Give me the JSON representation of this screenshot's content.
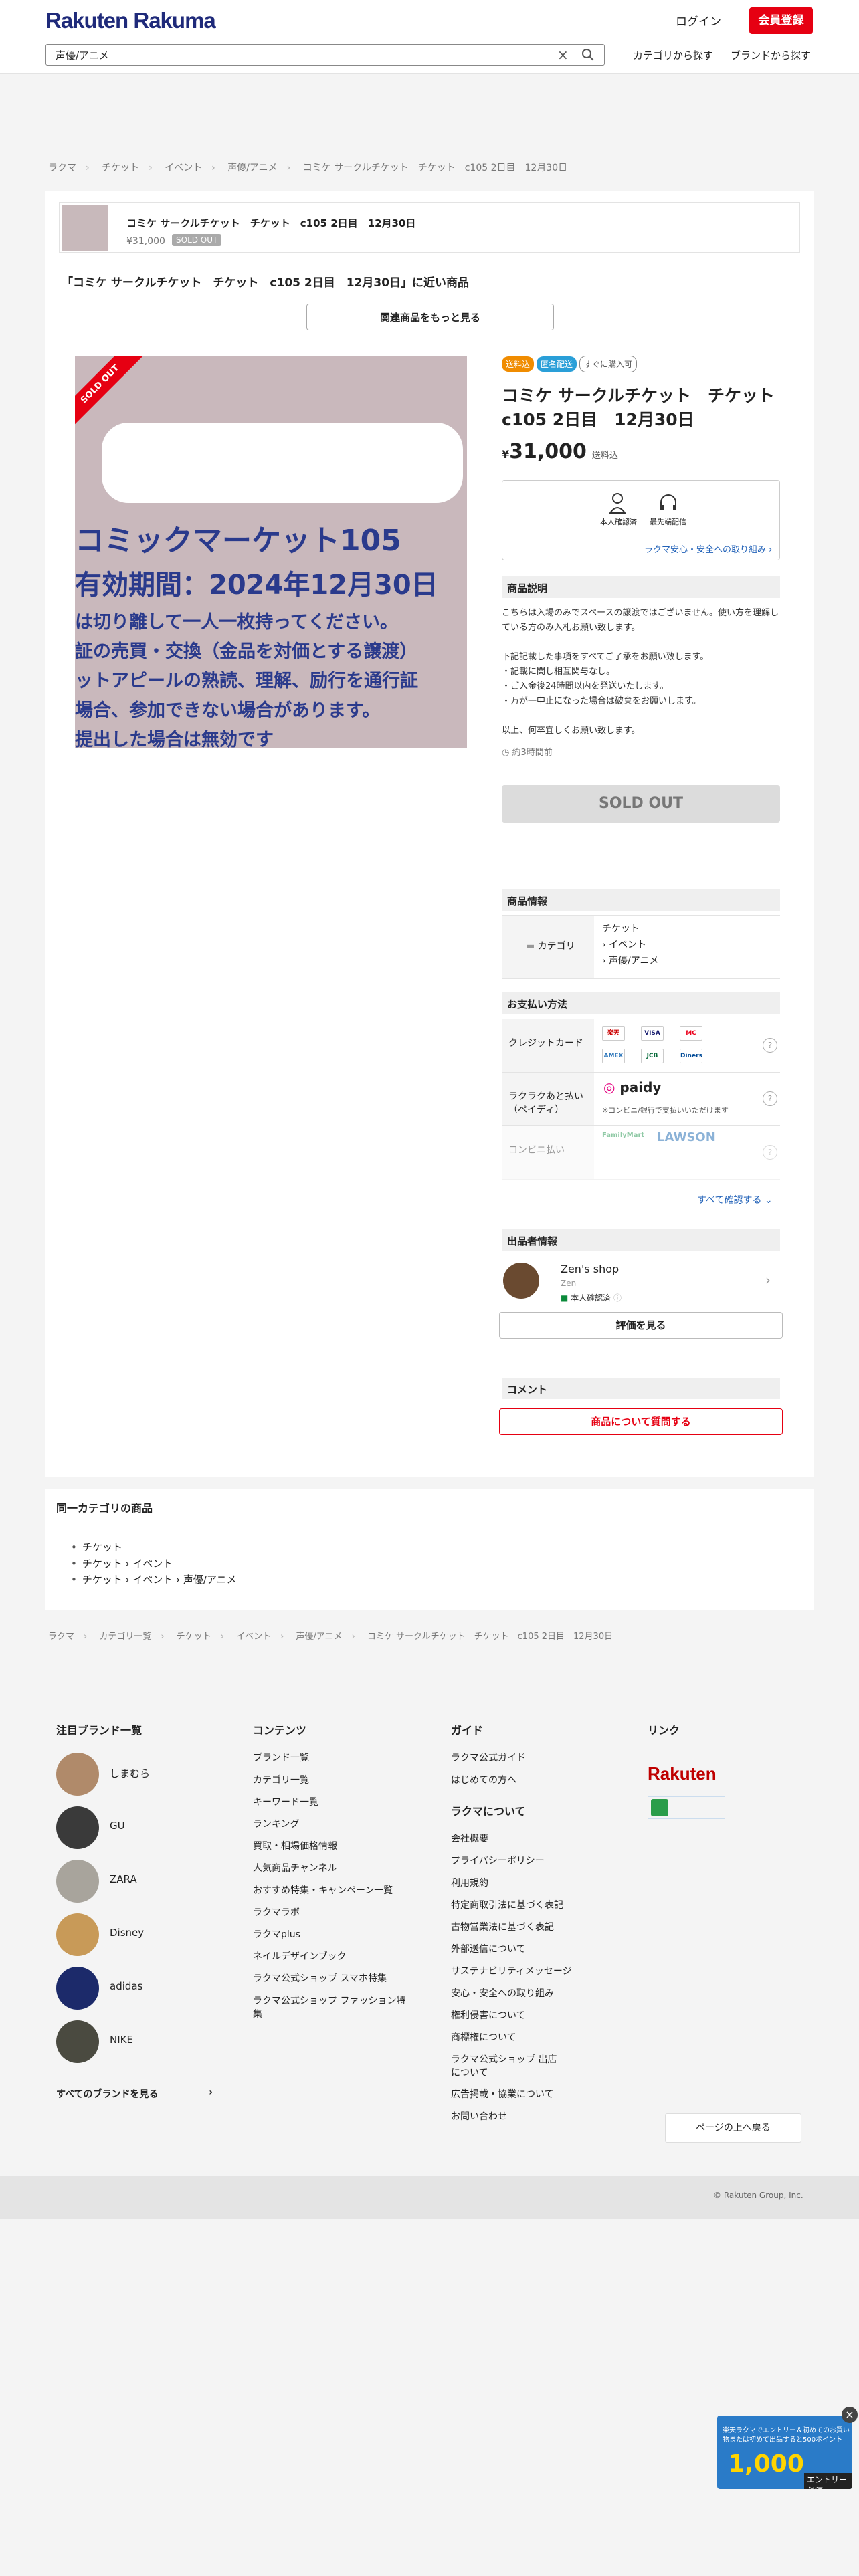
{
  "header": {
    "logo_main": "Rakuten",
    "logo_sub": "Rakuma",
    "login": "ログイン",
    "register": "会員登録",
    "search_value": "声優/アニメ",
    "nav_category": "カテゴリから探す",
    "nav_brand": "ブランドから探す"
  },
  "breadcrumb": [
    "ラクマ",
    "チケット",
    "イベント",
    "声優/アニメ",
    "コミケ サークルチケット　チケット　c105 2日目　12月30日"
  ],
  "mini": {
    "title": "コミケ サークルチケット　チケット　c105 2日目　12月30日",
    "price": "¥31,000",
    "status": "SOLD OUT"
  },
  "similar_heading": "「コミケ サークルチケット　チケット　c105 2日目　12月30日」に近い商品",
  "more_button": "関連商品をもっと見る",
  "photo": {
    "badge": "SOLD OUT",
    "lines": [
      "コミックマーケット105",
      "有効期間：2024年12月30日",
      "は切り離して一人一枚持ってください。",
      "証の売買・交換（金品を対価とする譲渡）",
      "ットアピールの熟読、理解、励行を通行証",
      "場合、参加できない場合があります。",
      "提出した場合は無効です"
    ]
  },
  "product": {
    "tags": [
      "送料込",
      "匿名配送",
      "すぐに購入可"
    ],
    "title": "コミケ サークルチケット　チケット　c105 2日目　12月30日",
    "yen": "¥",
    "price": "31,000",
    "shipping": "送料込"
  },
  "safety": {
    "item1": "本人確認済",
    "item2": "最先端配信",
    "link": "ラクマ安心・安全への取り組み"
  },
  "description": {
    "heading": "商品説明",
    "lines": [
      "こちらは入場のみでスペースの譲渡ではございません。使い方を理解している方のみ入札お願い致します。",
      "",
      "下記記載した事項をすべてご了承をお願い致します。",
      "・記載に関し相互関与なし。",
      "・ご入金後24時間以内を発送いたします。",
      "・万が一中止になった場合は破棄をお願いします。",
      "",
      "以上、何卒宜しくお願い致します。"
    ],
    "posted": "約3時間前"
  },
  "sold_button": "SOLD OUT",
  "item_info": {
    "heading": "商品情報",
    "category_label": "カテゴリ",
    "category_values": [
      "チケット",
      "› イベント",
      "› 声優/アニメ"
    ]
  },
  "payment": {
    "heading": "お支払い方法",
    "credit_label": "クレジットカード",
    "rakuraku_label": "ラクラクあと払い（ペイディ）",
    "paidy": "paidy",
    "paidy_note": "※コンビニ/銀行で支払いいただけます",
    "conveni_label": "コンビニ払い",
    "lawson": "LAWSON",
    "famima": "FamilyMart",
    "cards": [
      "楽天",
      "VISA",
      "MC",
      "AMEX",
      "JCB",
      "Diners"
    ],
    "see_all": "すべて確認する"
  },
  "seller": {
    "heading": "出品者情報",
    "name": "Zen's shop",
    "sub": "Zen",
    "verified": "本人確認済",
    "reviews_button": "評価を見る"
  },
  "comment": {
    "heading": "コメント",
    "ask_button": "商品について質問する"
  },
  "same_category": {
    "heading": "同一カテゴリの商品",
    "items": [
      "チケット",
      "チケット › イベント",
      "チケット › イベント › 声優/アニメ"
    ]
  },
  "breadcrumb2": [
    "ラクマ",
    "カテゴリ一覧",
    "チケット",
    "イベント",
    "声優/アニメ",
    "コミケ サークルチケット　チケット　c105 2日目　12月30日"
  ],
  "footer": {
    "brands_heading": "注目ブランド一覧",
    "brands": [
      "しまむら",
      "GU",
      "ZARA",
      "Disney",
      "adidas",
      "NIKE"
    ],
    "all_brands": "すべてのブランドを見る",
    "contents_heading": "コンテンツ",
    "contents": [
      "ブランド一覧",
      "カテゴリ一覧",
      "キーワード一覧",
      "ランキング",
      "買取・相場価格情報",
      "人気商品チャンネル",
      "おすすめ特集・キャンペーン一覧",
      "ラクマラボ",
      "ラクマplus",
      "ネイルデザインブック",
      "ラクマ公式ショップ スマホ特集",
      "ラクマ公式ショップ ファッション特集"
    ],
    "guide_heading": "ガイド",
    "guide": [
      "ラクマ公式ガイド",
      "はじめての方へ"
    ],
    "about_heading": "ラクマについて",
    "about": [
      "会社概要",
      "プライバシーポリシー",
      "利用規約",
      "特定商取引法に基づく表記",
      "古物営業法に基づく表記",
      "外部送信について",
      "サステナビリティメッセージ",
      "安心・安全への取り組み",
      "権利侵害について",
      "商標権について",
      "ラクマ公式ショップ 出店について",
      "広告掲載・協業について",
      "お問い合わせ"
    ],
    "links_heading": "リンク",
    "rakuten": "Rakuten",
    "to_top": "ページの上へ戻る",
    "copyright": "© Rakuten Group, Inc."
  },
  "promo": {
    "text": "楽天ラクマでエントリー＆初めてのお買い物または初めて出品すると500ポイント",
    "amount": "1,000",
    "entry": "エントリー必須"
  },
  "colors": {
    "brand_red": "#e60012",
    "logo_blue": "#1f2a7a",
    "link_blue": "#2262b8"
  }
}
